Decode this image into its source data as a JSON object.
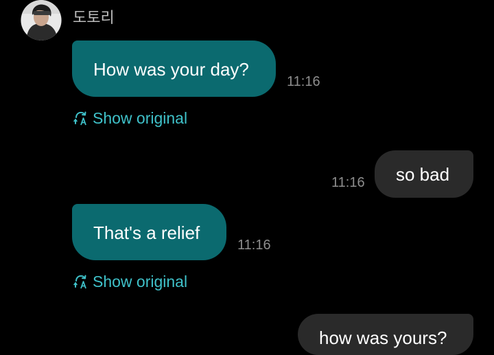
{
  "contact": {
    "name": "도토리",
    "avatar_icon": "profile-photo"
  },
  "messages": [
    {
      "direction": "incoming",
      "text": "How was your day?",
      "time": "11:16",
      "show_original": "Show original"
    },
    {
      "direction": "outgoing",
      "text": "so bad",
      "time": "11:16"
    },
    {
      "direction": "incoming",
      "text": "That's a relief",
      "time": "11:16",
      "show_original": "Show original"
    },
    {
      "direction": "outgoing",
      "text": "how was yours?"
    }
  ],
  "colors": {
    "background": "#000000",
    "incoming_bubble": "#0b6a6f",
    "outgoing_bubble": "#2a2a2a",
    "accent_link": "#3fc1c9",
    "timestamp": "#8e8e8e"
  },
  "icons": {
    "translate": "translate-icon"
  }
}
